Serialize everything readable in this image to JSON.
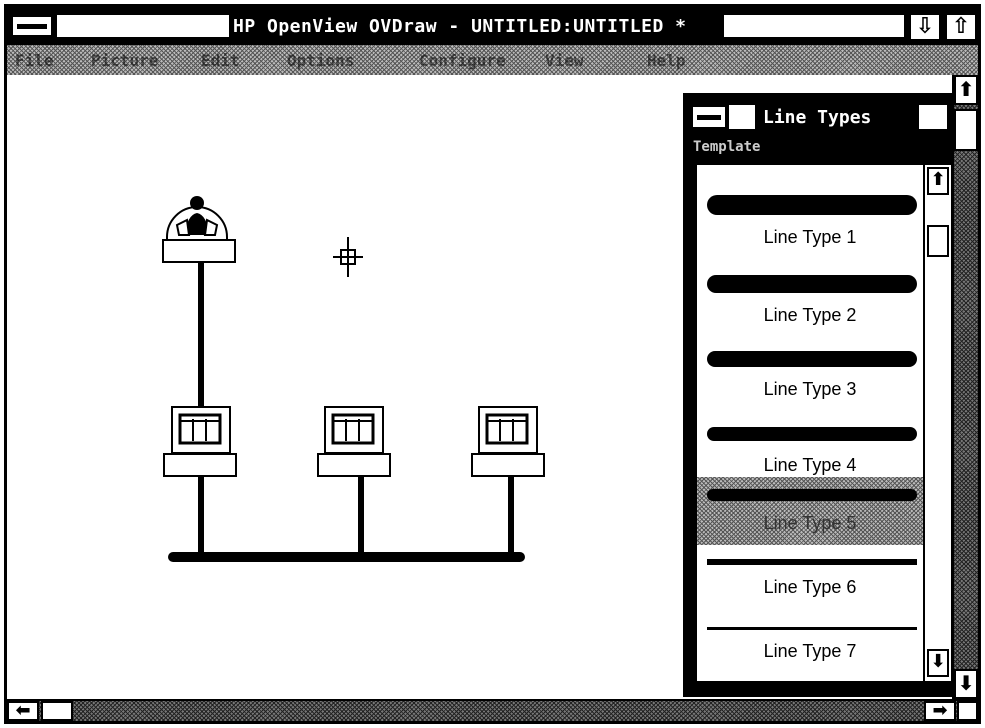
{
  "window": {
    "title": "HP OpenView OVDraw - UNTITLED:UNTITLED *",
    "minimize_icon": "⇩",
    "maximize_icon": "⇧"
  },
  "menu": {
    "items": [
      "File",
      "Picture",
      "Edit",
      "Options",
      "Configure",
      "View",
      "Help"
    ]
  },
  "palette": {
    "title": "Line Types",
    "menu_label": "Template",
    "scroll_up_icon": "arrow-up-icon",
    "scroll_down_icon": "arrow-down-icon",
    "line_types": [
      {
        "label": "Line Type 1",
        "selected": false
      },
      {
        "label": "Line Type 2",
        "selected": false
      },
      {
        "label": "Line Type 3",
        "selected": false
      },
      {
        "label": "Line Type 4",
        "selected": false
      },
      {
        "label": "Line Type 5",
        "selected": true
      },
      {
        "label": "Line Type 6",
        "selected": false
      },
      {
        "label": "Line Type 7",
        "selected": false
      }
    ]
  },
  "canvas": {
    "icons": [
      "operator-icon",
      "computer-node-icon",
      "computer-node-icon",
      "computer-node-icon"
    ],
    "cursor": "crosshair-cursor-icon"
  },
  "scrollbars": {
    "up_icon": "⬆",
    "down_icon": "⬇",
    "left_icon": "⬅",
    "right_icon": "➡"
  }
}
